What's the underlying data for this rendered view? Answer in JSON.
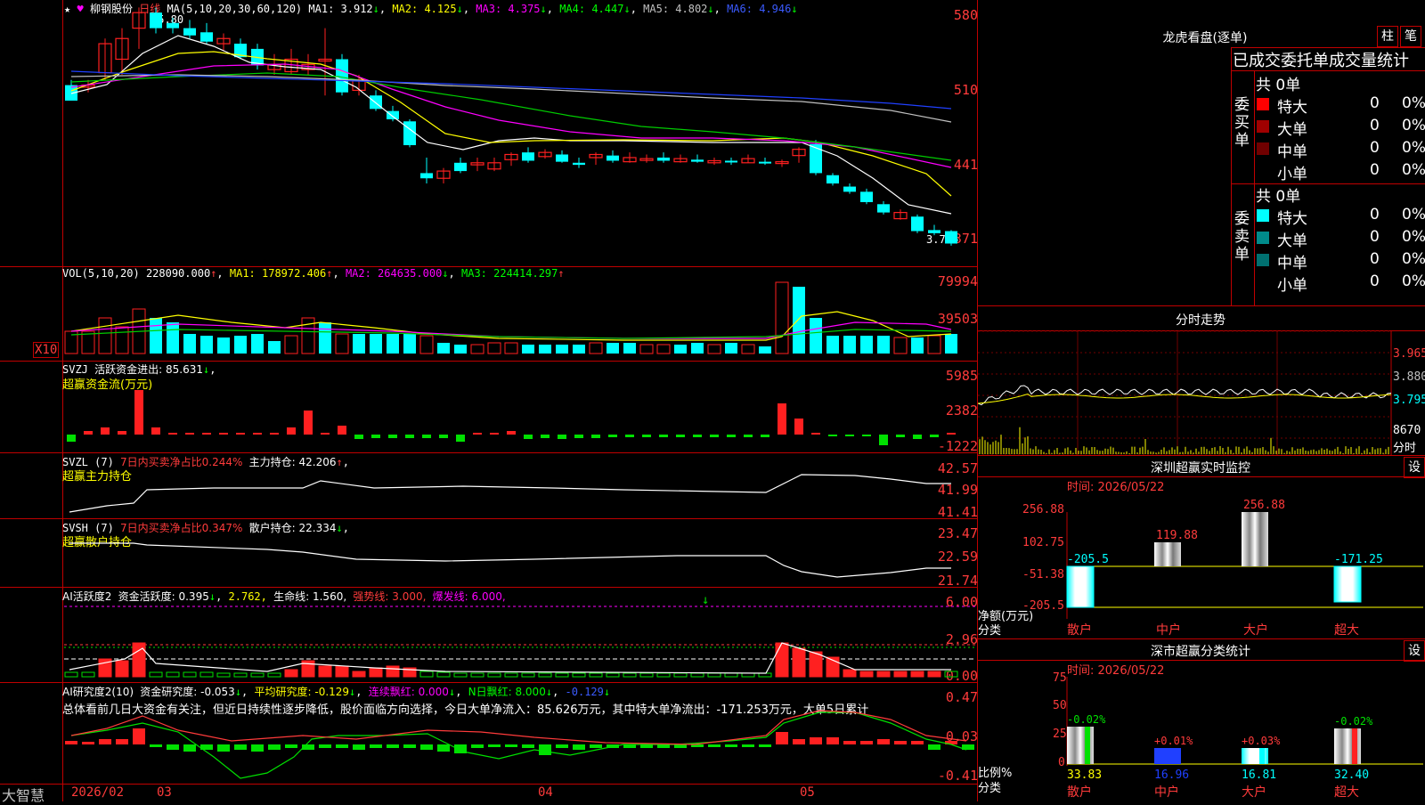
{
  "stock": {
    "name": "柳钢股份",
    "period": "日线",
    "ma_label": "MA(5,10,20,30,60,120)",
    "ma1": "MA1: 3.912",
    "ma2": "MA2: 4.125",
    "ma3": "MA3: 4.375",
    "ma4": "MA4: 4.447",
    "ma5": "MA5: 4.802",
    "ma6": "MA6: 4.946",
    "high_label": "5.80",
    "low_label": "3.71"
  },
  "price_axis": [
    "580",
    "510",
    "441",
    "371"
  ],
  "vol": {
    "label": "VOL(5,10,20)",
    "value": "228090.000",
    "ma1": "MA1: 178972.406",
    "ma2": "MA2: 264635.000",
    "ma3": "MA3: 224414.297",
    "axis": [
      "79994",
      "39503",
      "X10"
    ]
  },
  "svzj": {
    "label": "SVZJ",
    "desc": "活跃资金进出: 85.631",
    "sub": "超赢资金流(万元)",
    "axis": [
      "5985",
      "2382",
      "-1222"
    ]
  },
  "svzl": {
    "label": "SVZL (7)",
    "desc1": "7日内买卖净占比0.244%",
    "desc2": "主力持仓: 42.206",
    "sub": "超赢主力持仓",
    "axis": [
      "42.57",
      "41.99",
      "41.41"
    ]
  },
  "svsh": {
    "label": "SVSH (7)",
    "desc1": "7日内买卖净占比0.347%",
    "desc2": "散户持仓: 22.334",
    "sub": "超赢散户持仓",
    "axis": [
      "23.47",
      "22.59",
      "21.74"
    ]
  },
  "ai_active": {
    "label": "AI活跃度2",
    "desc1": "资金活跃度: 0.395",
    "desc2": "2.762,",
    "desc3": "生命线: 1.560,",
    "desc4": "强势线: 3.000,",
    "desc5": "爆发线: 6.000,",
    "axis": [
      "6.00",
      "2.96",
      "0.00"
    ]
  },
  "ai_research": {
    "label": "AI研究度2(10)",
    "desc1": "资金研究度: -0.053",
    "desc2": "平均研究度: -0.129",
    "desc3": "连续飘红: 0.000",
    "desc4": "N日飘红: 8.000",
    "desc5": "-0.129",
    "summary": "总体看前几日大资金有关注，但近日持续性逐步降低，股价面临方向选择，今日大单净流入：85.626万元，其中特大单净流出：-171.253万元，大单5日累计",
    "axis": [
      "0.47",
      "0.03",
      "-0.41"
    ]
  },
  "date_axis": {
    "brand": "大智慧",
    "labels": [
      "2026/02",
      "03",
      "04",
      "05"
    ]
  },
  "right_panel": {
    "longhu_title": "龙虎看盘(逐单)",
    "btn_zhu": "柱",
    "btn_bi": "笔",
    "order_title": "已成交委托单成交量统计",
    "buy_group": "委买单",
    "sell_group": "委卖单",
    "buy_total": "共 0单",
    "sell_total": "共 0单",
    "rows": [
      {
        "name": "特大",
        "count": "0",
        "pct": "0%"
      },
      {
        "name": "大单",
        "count": "0",
        "pct": "0%"
      },
      {
        "name": "中单",
        "count": "0",
        "pct": "0%"
      },
      {
        "name": "小单",
        "count": "0",
        "pct": "0%"
      }
    ],
    "fenshi_title": "分时走势",
    "fenshi_axis": [
      "3.965",
      "3.880",
      "3.795",
      "8670",
      "分时"
    ],
    "monitor_title": "深圳超赢实时监控",
    "monitor_btn": "设",
    "monitor_time": "时间: 2026/05/22",
    "monitor_axis": [
      "256.88",
      "102.75",
      "-51.38",
      "-205.5"
    ],
    "monitor_ylabel1": "净额(万元)",
    "monitor_ylabel2": "分类",
    "monitor_cats": [
      "散户",
      "中户",
      "大户",
      "超大"
    ],
    "monitor_values": [
      "-205.5",
      "119.88",
      "256.88",
      "-171.25"
    ],
    "stat_title": "深市超赢分类统计",
    "stat_btn": "设",
    "stat_time": "时间: 2026/05/22",
    "stat_axis": [
      "75",
      "50",
      "25",
      "0"
    ],
    "stat_ylabel1": "比例%",
    "stat_ylabel2": "分类",
    "stat_top": [
      "-0.02%",
      "+0.01%",
      "+0.03%",
      "-0.02%"
    ],
    "stat_bottom": [
      "33.83",
      "16.96",
      "16.81",
      "32.40"
    ],
    "stat_cats": [
      "散户",
      "中户",
      "大户",
      "超大"
    ]
  },
  "colors": {
    "up": "#ff2020",
    "down": "#00ffff",
    "grid": "#c00000"
  }
}
